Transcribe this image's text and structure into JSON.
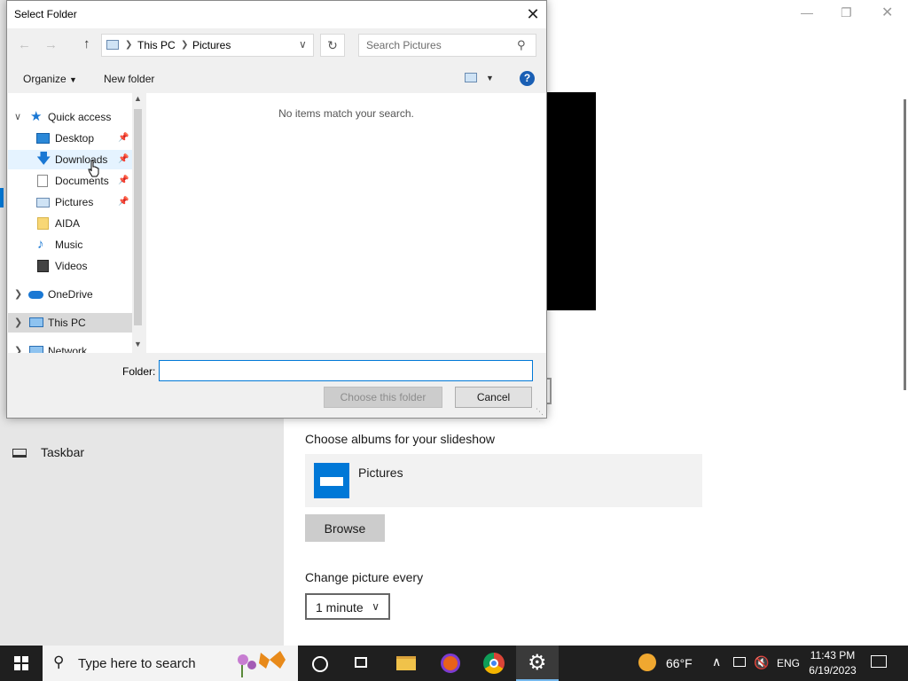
{
  "settings": {
    "nav_taskbar": "Taskbar",
    "choose_albums_label": "Choose albums for your slideshow",
    "album_name": "Pictures",
    "browse_label": "Browse",
    "change_picture_label": "Change picture every",
    "interval_value": "1 minute"
  },
  "dialog": {
    "title": "Select Folder",
    "breadcrumb": [
      "This PC",
      "Pictures"
    ],
    "search_placeholder": "Search Pictures",
    "toolbar": {
      "organize": "Organize",
      "new_folder": "New folder"
    },
    "tree": {
      "quick_access": "Quick access",
      "items": [
        "Desktop",
        "Downloads",
        "Documents",
        "Pictures",
        "AIDA",
        "Music",
        "Videos"
      ],
      "onedrive": "OneDrive",
      "this_pc": "This PC",
      "network": "Network"
    },
    "empty_message": "No items match your search.",
    "folder_label": "Folder:",
    "folder_value": "",
    "choose_button": "Choose this folder",
    "cancel_button": "Cancel"
  },
  "taskbar": {
    "search_placeholder": "Type here to search",
    "weather": "66°F",
    "language": "ENG",
    "time": "11:43 PM",
    "date": "6/19/2023"
  },
  "colors": {
    "accent": "#0078d7",
    "taskbar": "#1f1f1f"
  }
}
